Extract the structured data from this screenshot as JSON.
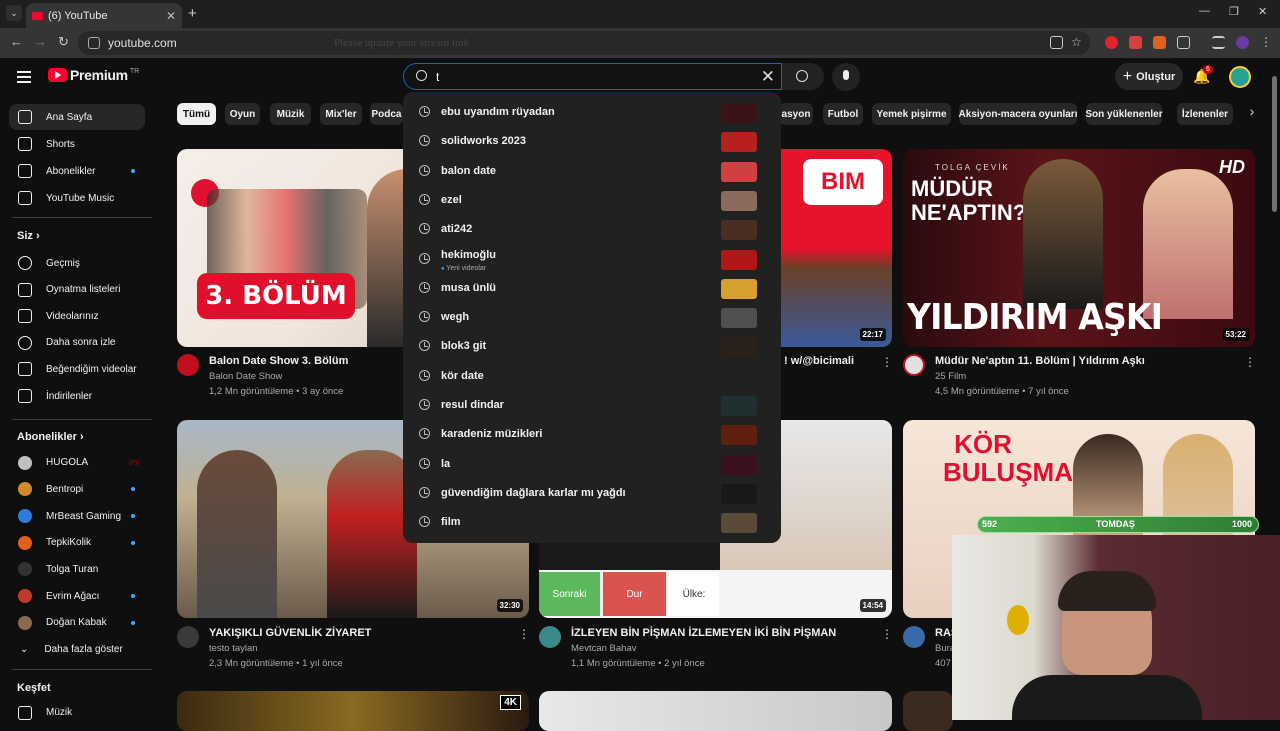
{
  "browser": {
    "tab_title": "(6) YouTube",
    "url": "youtube.com",
    "overlay_text": "Please update your stream link",
    "colors": {
      "tabstrip": "#1f1f1f",
      "toolbar": "#353535"
    }
  },
  "header": {
    "logo_text": "Premium",
    "logo_region": "TR",
    "search_query": "t",
    "create_label": "Oluştur",
    "notification_count": "6"
  },
  "sidebar": {
    "main": [
      {
        "label": "Ana Sayfa",
        "icon": "home-icon"
      },
      {
        "label": "Shorts",
        "icon": "shorts-icon"
      },
      {
        "label": "Abonelikler",
        "icon": "subscriptions-icon"
      },
      {
        "label": "YouTube Music",
        "icon": "music-icon"
      }
    ],
    "you_heading": "Siz",
    "you": [
      {
        "label": "Geçmiş",
        "icon": "history-icon"
      },
      {
        "label": "Oynatma listeleri",
        "icon": "playlists-icon"
      },
      {
        "label": "Videolarınız",
        "icon": "your-videos-icon"
      },
      {
        "label": "Daha sonra izle",
        "icon": "watch-later-icon"
      },
      {
        "label": "Beğendiğim videolar",
        "icon": "like-icon"
      },
      {
        "label": "İndirilenler",
        "icon": "download-icon"
      }
    ],
    "subs_heading": "Abonelikler",
    "subs": [
      {
        "label": "HUGOLA",
        "color": "#c0c0c0"
      },
      {
        "label": "Bentropi",
        "color": "#d28a2c"
      },
      {
        "label": "MrBeast Gaming",
        "color": "#2f7bd6"
      },
      {
        "label": "TepkiKolik",
        "color": "#e06020"
      },
      {
        "label": "Tolga Turan",
        "color": "#333333"
      },
      {
        "label": "Evrim Ağacı",
        "color": "#c0392b"
      },
      {
        "label": "Doğan Kabak",
        "color": "#8a6a50"
      }
    ],
    "more_label": "Daha fazla göster",
    "explore_heading": "Keşfet",
    "explore_item": "Müzik"
  },
  "chips": [
    "Tümü",
    "Oyun",
    "Müzik",
    "Mix'ler",
    "Podca",
    "asyon",
    "Futbol",
    "Yemek pişirme",
    "Aksiyon-macera oyunları",
    "Son yüklenenler",
    "İzlenenler"
  ],
  "suggestions": [
    {
      "label": "ebu uyandım rüyadan",
      "sub": "",
      "thumb": "#3a1414"
    },
    {
      "label": "solidworks 2023",
      "sub": "",
      "thumb": "#b82020"
    },
    {
      "label": "balon date",
      "sub": "",
      "thumb": "#d04040"
    },
    {
      "label": "ezel",
      "sub": "",
      "thumb": "#8a6a5a"
    },
    {
      "label": "ati242",
      "sub": "",
      "thumb": "#4a2e24"
    },
    {
      "label": "hekimoğlu",
      "sub": "Yeni videolar",
      "thumb": "#b01818"
    },
    {
      "label": "musa ünlü",
      "sub": "",
      "thumb": "#d8a030"
    },
    {
      "label": "wegh",
      "sub": "",
      "thumb": "#505050"
    },
    {
      "label": "blok3 git",
      "sub": "",
      "thumb": "#2a2218"
    },
    {
      "label": "kör date",
      "sub": "",
      "thumb": ""
    },
    {
      "label": "resul dindar",
      "sub": "",
      "thumb": "#203030"
    },
    {
      "label": "karadeniz müzikleri",
      "sub": "",
      "thumb": "#602010"
    },
    {
      "label": "la",
      "sub": "",
      "thumb": "#3a1020"
    },
    {
      "label": "güvendiğim dağlara karlar mı yağdı",
      "sub": "",
      "thumb": "#181818"
    },
    {
      "label": "film",
      "sub": "",
      "thumb": "#5a4a3a"
    }
  ],
  "videos_row1": [
    {
      "title": "Balon Date Show 3. Bölüm",
      "channel": "Balon Date Show",
      "meta": "1,2 Mn görüntüleme • 3 ay önce",
      "thumb_text": "3. BÖLÜM",
      "duration": ""
    },
    {
      "title": "! w/@bicimali",
      "channel": "",
      "meta": "",
      "thumb_text": "BIM",
      "duration": "22:17"
    },
    {
      "title": "Müdür Ne'aptın 11. Bölüm | Yıldırım Aşkı",
      "channel": "25 Film",
      "meta": "4,5 Mn görüntüleme • 7 yıl önce",
      "thumb_text": "YILDIRIM AŞKI",
      "thumb_top": "MÜDÜR NE'APTIN?",
      "thumb_small": "TOLGA ÇEVİK",
      "hd": "HD",
      "duration": "53:22"
    }
  ],
  "videos_row2": [
    {
      "title": "YAKIŞIKLI GÜVENLİK ZİYARET",
      "channel": "testo taylan",
      "meta": "2,3 Mn görüntüleme • 1 yıl önce",
      "duration": "32:30"
    },
    {
      "title": "İZLEYEN BİN PİŞMAN İZLEMEYEN İKİ BİN PİŞMAN",
      "channel": "Mevtcan Bahav",
      "meta": "1,1 Mn görüntüleme • 2 yıl önce",
      "duration": "14:54",
      "btn_next": "Sonraki",
      "btn_stop": "Dur",
      "btn_country": "Ülke:"
    },
    {
      "title": "RAS",
      "channel": "Bura",
      "meta": "407",
      "thumb_text": "KÖR BULUŞMA"
    }
  ],
  "row3_badge": "4K",
  "stream_overlay": {
    "left_score": "592",
    "name": "TOMDAŞ",
    "right_score": "1000"
  }
}
